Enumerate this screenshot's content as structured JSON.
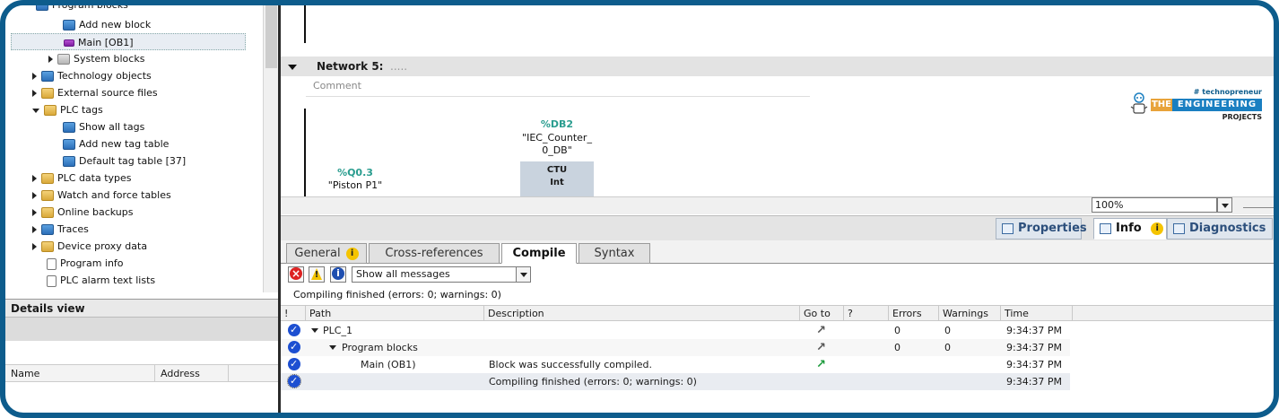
{
  "project_tree": {
    "items": [
      {
        "label": "Program blocks",
        "icon": "folder-icon",
        "indent": 1,
        "expander": "down"
      },
      {
        "label": "Add new block",
        "icon": "add-block-icon",
        "indent": 3,
        "expander": "none"
      },
      {
        "label": "Main [OB1]",
        "icon": "ob-block-icon",
        "indent": 3,
        "expander": "none",
        "selected": true
      },
      {
        "label": "System blocks",
        "icon": "system-blocks-icon",
        "indent": 2,
        "expander": "right"
      },
      {
        "label": "Technology objects",
        "icon": "technology-icon",
        "indent": 1,
        "expander": "right"
      },
      {
        "label": "External source files",
        "icon": "source-files-icon",
        "indent": 1,
        "expander": "right"
      },
      {
        "label": "PLC tags",
        "icon": "plc-tags-icon",
        "indent": 1,
        "expander": "down"
      },
      {
        "label": "Show all tags",
        "icon": "tags-icon",
        "indent": 3,
        "expander": "none"
      },
      {
        "label": "Add new tag table",
        "icon": "add-table-icon",
        "indent": 3,
        "expander": "none"
      },
      {
        "label": "Default tag table [37]",
        "icon": "tag-table-icon",
        "indent": 3,
        "expander": "none"
      },
      {
        "label": "PLC data types",
        "icon": "data-types-icon",
        "indent": 1,
        "expander": "right"
      },
      {
        "label": "Watch and force tables",
        "icon": "watch-icon",
        "indent": 1,
        "expander": "right"
      },
      {
        "label": "Online backups",
        "icon": "backup-icon",
        "indent": 1,
        "expander": "right"
      },
      {
        "label": "Traces",
        "icon": "traces-icon",
        "indent": 1,
        "expander": "right"
      },
      {
        "label": "Device proxy data",
        "icon": "proxy-icon",
        "indent": 1,
        "expander": "right"
      },
      {
        "label": "Program info",
        "icon": "program-info-icon",
        "indent": 2,
        "expander": "none"
      },
      {
        "label": "PLC alarm text lists",
        "icon": "alarm-list-icon",
        "indent": 2,
        "expander": "none"
      }
    ]
  },
  "details_view": {
    "title": "Details view",
    "col_name": "Name",
    "col_address": "Address"
  },
  "editor": {
    "network_title": "Network 5:",
    "network_dots": ".....",
    "comment_placeholder": "Comment",
    "db_tag": "%DB2",
    "db_name_line1": "\"IEC_Counter_",
    "db_name_line2": "0_DB\"",
    "ctu_label": "CTU",
    "ctu_type": "Int",
    "q_tag": "%Q0.3",
    "q_name": "\"Piston P1\"",
    "zoom": "100%"
  },
  "logo": {
    "hashtag": "# technopreneur",
    "the": "THE",
    "engineering": "ENGINEERING",
    "projects": "PROJECTS"
  },
  "inspector_tabs": [
    {
      "label": "Properties",
      "active": false
    },
    {
      "label": "Info",
      "active": true
    },
    {
      "label": "Diagnostics",
      "active": false
    }
  ],
  "info_tabs": [
    {
      "label": "General",
      "active": false
    },
    {
      "label": "Cross-references",
      "active": false
    },
    {
      "label": "Compile",
      "active": true
    },
    {
      "label": "Syntax",
      "active": false
    }
  ],
  "info_badge": "i",
  "filter": {
    "selected": "Show all messages"
  },
  "status": "Compiling finished (errors: 0; warnings: 0)",
  "table": {
    "headers": {
      "bang": "!",
      "path": "Path",
      "description": "Description",
      "goto": "Go to",
      "q": "?",
      "errors": "Errors",
      "warnings": "Warnings",
      "time": "Time"
    },
    "rows": [
      {
        "path": "PLC_1",
        "description": "",
        "goto": "gray",
        "errors": "0",
        "warnings": "0",
        "time": "9:34:37 PM"
      },
      {
        "path": "Program blocks",
        "description": "",
        "goto": "gray",
        "errors": "0",
        "warnings": "0",
        "time": "9:34:37 PM"
      },
      {
        "path": "Main (OB1)",
        "description": "Block was successfully compiled.",
        "goto": "green",
        "errors": "",
        "warnings": "",
        "time": "9:34:37 PM"
      },
      {
        "path": "",
        "description": "Compiling finished (errors: 0; warnings: 0)",
        "goto": "",
        "errors": "",
        "warnings": "",
        "time": "9:34:37 PM"
      }
    ]
  },
  "colors": {
    "frame": "#0d5c8c",
    "tag_green": "#2a9d8f",
    "goto_green": "#1a9a3a",
    "ok_blue": "#1d4fd1"
  }
}
